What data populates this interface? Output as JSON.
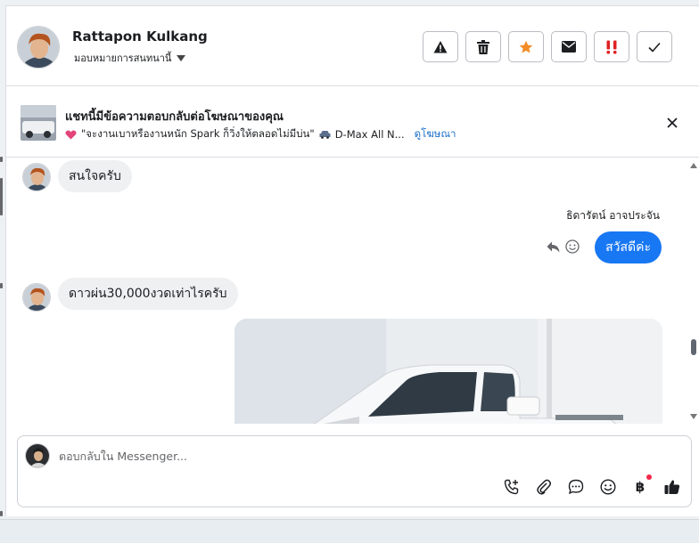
{
  "header": {
    "contact_name": "Rattapon Kulkang",
    "assign_label": "มอบหมายการสนทนานี้",
    "actions": [
      {
        "name": "report",
        "icon": "warning-icon"
      },
      {
        "name": "delete",
        "icon": "trash-icon"
      },
      {
        "name": "star",
        "icon": "star-icon",
        "color": "#f28c28"
      },
      {
        "name": "mark-unread",
        "icon": "mail-icon"
      },
      {
        "name": "important",
        "icon": "double-exclamation-icon",
        "color": "#e02020"
      },
      {
        "name": "done",
        "icon": "check-icon"
      }
    ]
  },
  "ad_banner": {
    "title": "แชทนี้มีข้อความตอบกลับต่อโฆษณาของคุณ",
    "snippet": "\"จะงานเบาหรืองานหนัก Spark ก็วิ่งให้ตลอดไม่มีบ่น\"",
    "product": "D-Max All N...",
    "link_label": "ดูโฆษณา"
  },
  "messages": [
    {
      "direction": "in",
      "text": "สนใจครับ"
    },
    {
      "direction": "out",
      "sender": "ธิดารัตน์ อาจประจัน",
      "text": "สวัสดีค่ะ"
    },
    {
      "direction": "in",
      "text": "ดาวผ่น30,000งวดเท่าไรครับ"
    },
    {
      "direction": "out",
      "type": "photo",
      "subject": "white pickup truck"
    }
  ],
  "composer": {
    "placeholder": "ตอบกลับใน Messenger...",
    "value": "",
    "tools": [
      "call-add-icon",
      "paperclip-icon",
      "chat-bubble-icon",
      "emoji-icon",
      "baht-icon",
      "thumbs-up-icon"
    ],
    "baht_label": "฿"
  },
  "colors": {
    "accent": "#1877f2",
    "link": "#1a6fc9",
    "incoming_bubble": "#eff0f2"
  }
}
